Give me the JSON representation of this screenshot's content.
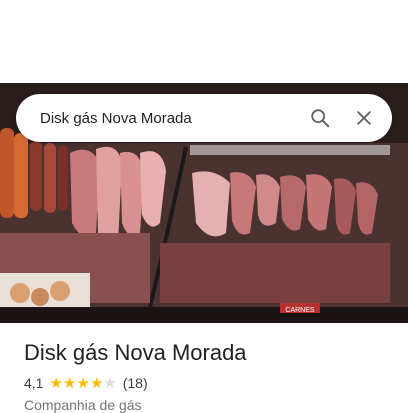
{
  "search": {
    "query": "Disk gás Nova Morada",
    "search_icon": "search-icon",
    "close_icon": "close-icon"
  },
  "photo": {
    "description_icon": "place-photo",
    "sign_text": "CARNES"
  },
  "place": {
    "title": "Disk gás Nova Morada",
    "rating": "4,1",
    "rating_value": 4.1,
    "stars_total": 5,
    "reviews": "(18)",
    "category": "Companhia de gás"
  },
  "colors": {
    "star_filled": "#fbbc04",
    "star_empty": "#dadce0",
    "icon": "#5f6368"
  }
}
